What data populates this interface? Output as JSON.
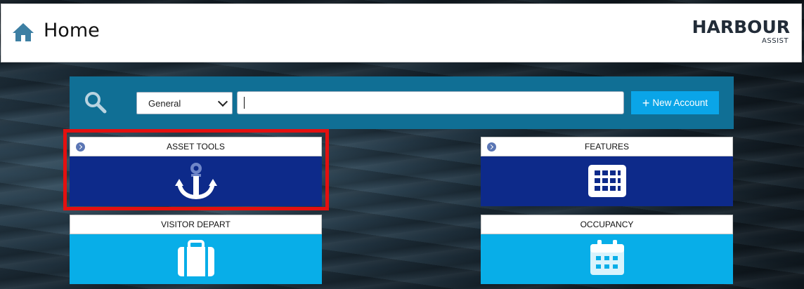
{
  "header": {
    "title": "Home",
    "logo_main": "HARBOUR",
    "logo_sub": "ASSIST"
  },
  "search": {
    "scope_selected": "General",
    "query_value": "",
    "new_account_label": "New Account"
  },
  "tiles": [
    {
      "label": "ASSET TOOLS",
      "icon": "anchor-icon",
      "has_arrow": true,
      "highlighted": true
    },
    {
      "label": "FEATURES",
      "icon": "grid-icon",
      "has_arrow": true,
      "highlighted": false
    },
    {
      "label": "VISITOR DEPART",
      "icon": "suitcase-icon",
      "has_arrow": false,
      "highlighted": false
    },
    {
      "label": "OCCUPANCY",
      "icon": "calendar-icon",
      "has_arrow": false,
      "highlighted": false
    }
  ],
  "colors": {
    "header_bg": "#ffffff",
    "search_panel": "#106f95",
    "button_blue": "#0aa5e8",
    "tile_dark": "#0d2a8a",
    "tile_light": "#08aee8",
    "highlight": "#e41010"
  }
}
